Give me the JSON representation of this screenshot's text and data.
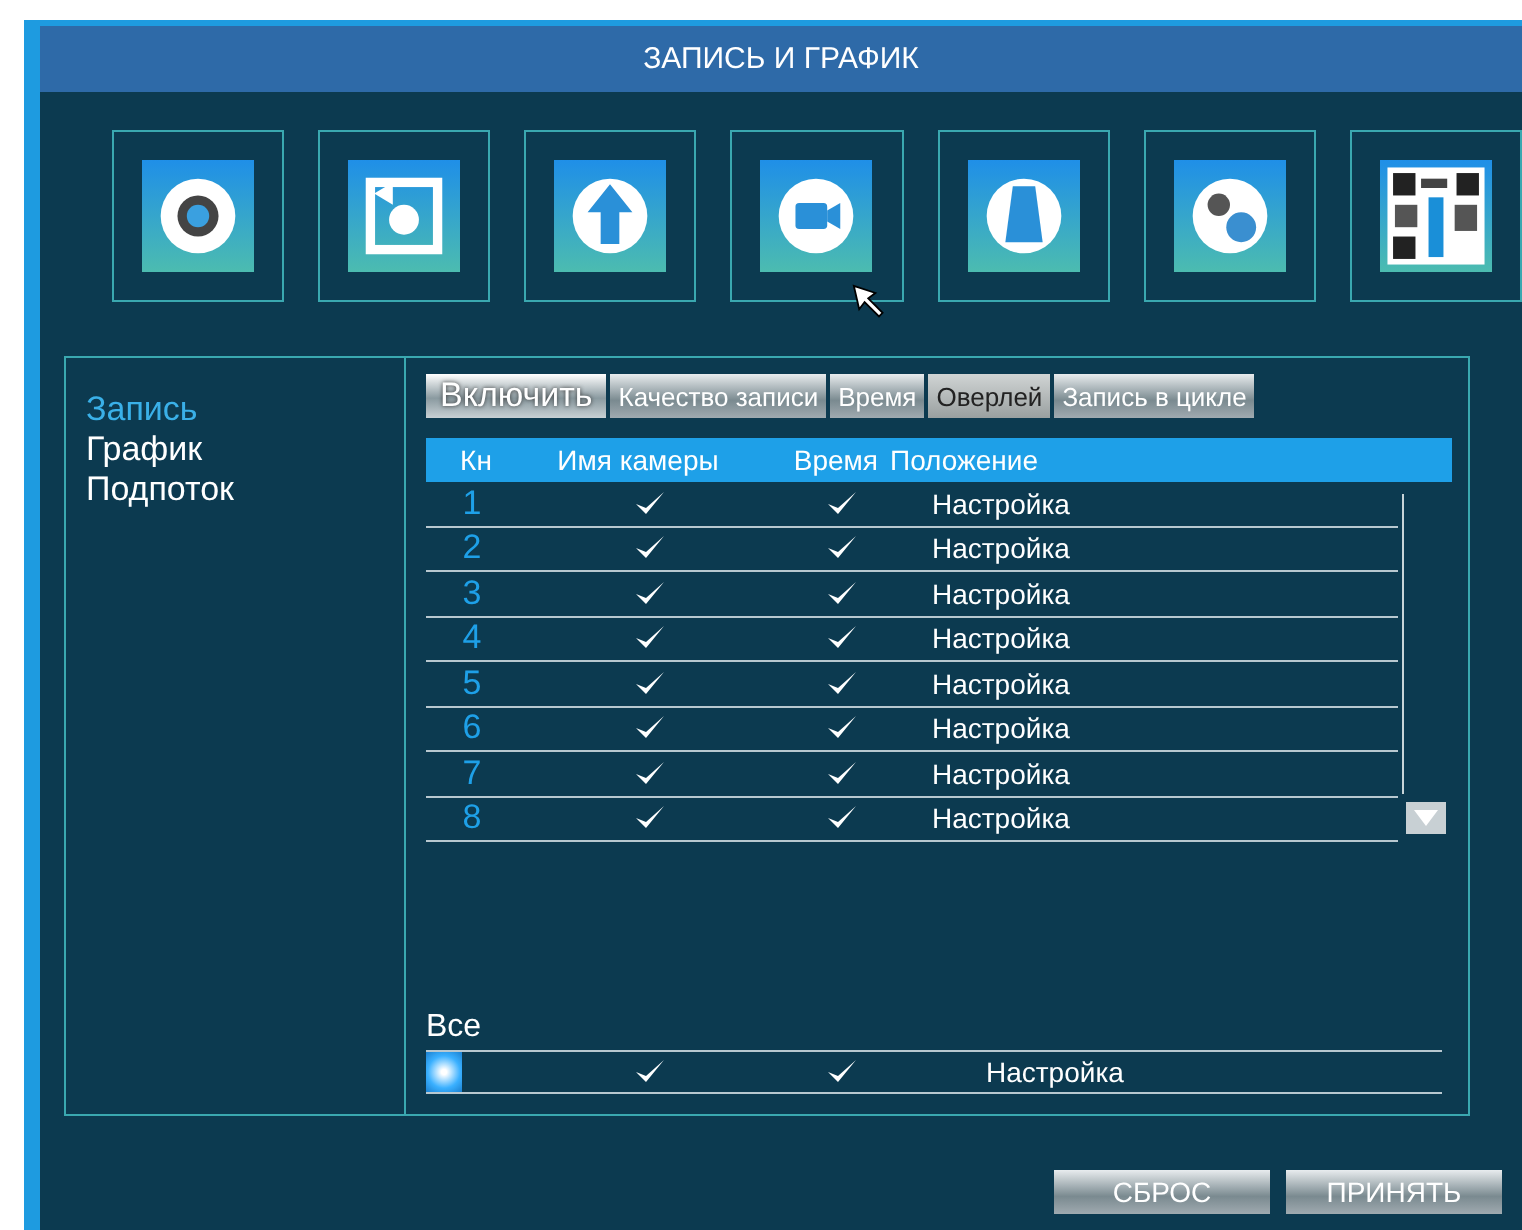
{
  "window": {
    "title": "ЗАПИСЬ И ГРАФИК"
  },
  "toolbar": [
    {
      "kind": "gear"
    },
    {
      "kind": "playback"
    },
    {
      "kind": "upload"
    },
    {
      "kind": "camera"
    },
    {
      "kind": "bell"
    },
    {
      "kind": "gears"
    },
    {
      "kind": "qr"
    }
  ],
  "sidebar": {
    "items": [
      {
        "label": "Запись",
        "selected": true
      },
      {
        "label": "График",
        "selected": false
      },
      {
        "label": "Подпоток",
        "selected": false
      }
    ]
  },
  "tabs": [
    {
      "label": "Включить",
      "selected": true,
      "hovered": false
    },
    {
      "label": "Качество записи",
      "selected": false,
      "hovered": false
    },
    {
      "label": "Время",
      "selected": false,
      "hovered": false
    },
    {
      "label": "Оверлей",
      "selected": false,
      "hovered": true
    },
    {
      "label": "Запись в цикле",
      "selected": false,
      "hovered": false
    }
  ],
  "table": {
    "columns": [
      "Кн",
      "Имя камеры",
      "Время",
      "Положение"
    ],
    "rows": [
      {
        "channel": "1",
        "camera": true,
        "time": true,
        "position": "Настройка"
      },
      {
        "channel": "2",
        "camera": true,
        "time": true,
        "position": "Настройка"
      },
      {
        "channel": "3",
        "camera": true,
        "time": true,
        "position": "Настройка"
      },
      {
        "channel": "4",
        "camera": true,
        "time": true,
        "position": "Настройка"
      },
      {
        "channel": "5",
        "camera": true,
        "time": true,
        "position": "Настройка"
      },
      {
        "channel": "6",
        "camera": true,
        "time": true,
        "position": "Настройка"
      },
      {
        "channel": "7",
        "camera": true,
        "time": true,
        "position": "Настройка"
      },
      {
        "channel": "8",
        "camera": true,
        "time": true,
        "position": "Настройка"
      }
    ]
  },
  "all_row": {
    "label": "Все",
    "checked": true,
    "camera": true,
    "time": true,
    "position": "Настройка"
  },
  "buttons": [
    "СБРОС",
    "ПРИНЯТЬ"
  ]
}
